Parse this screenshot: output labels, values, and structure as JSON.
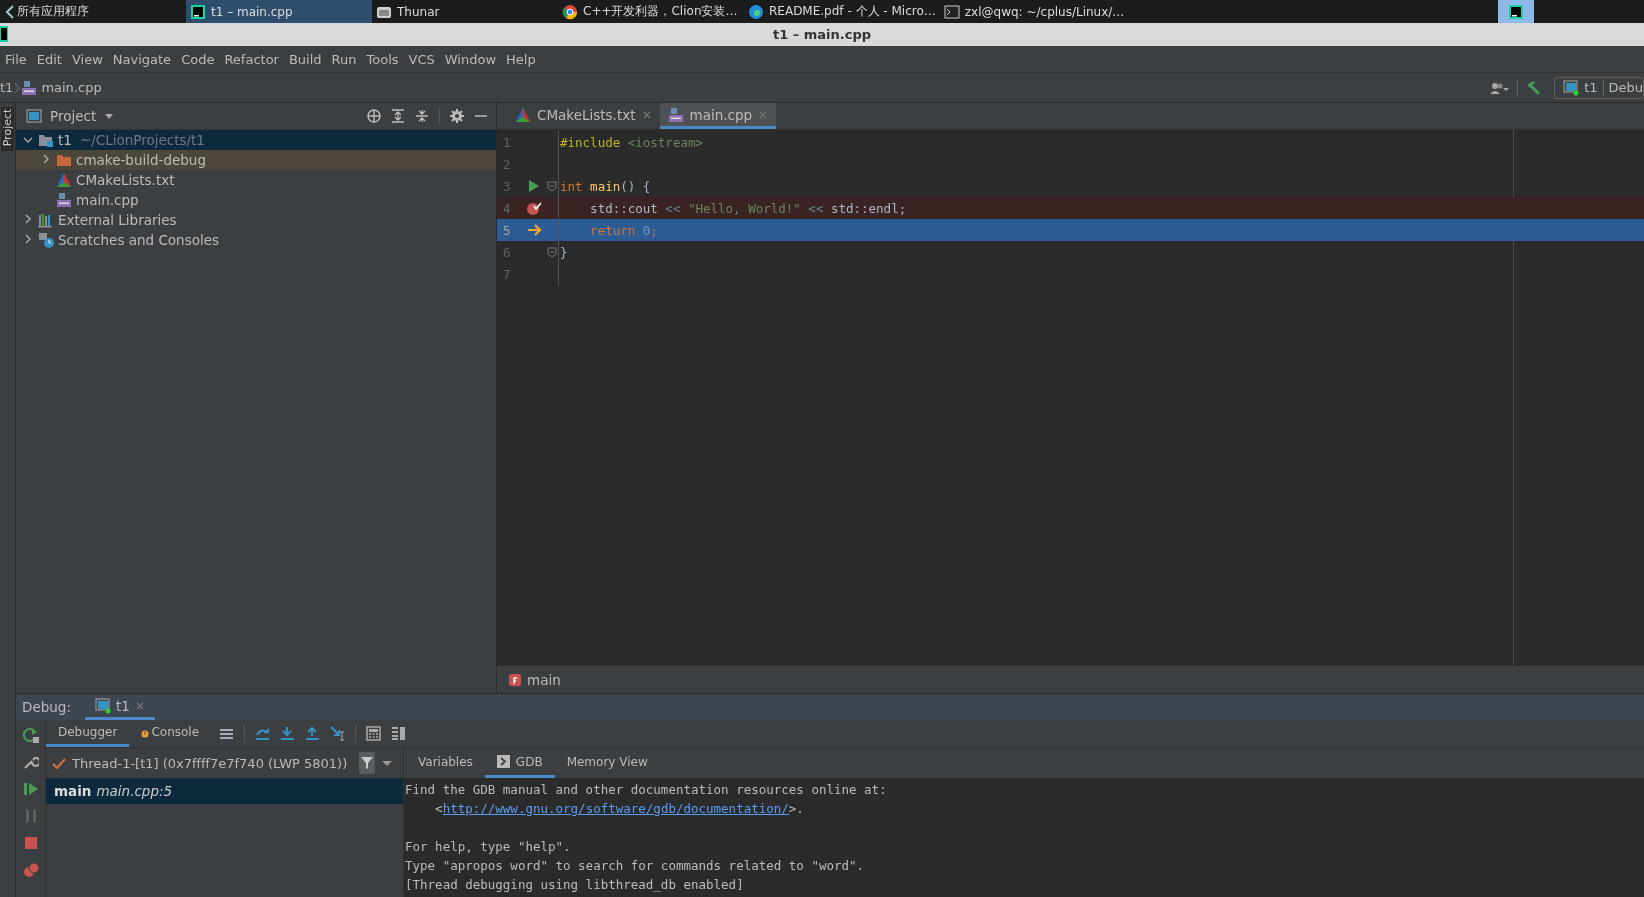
{
  "taskbar": {
    "items": [
      {
        "label": "所有应用程序",
        "kind": "start",
        "selected": false
      },
      {
        "label": "t1 – main.cpp",
        "kind": "clion",
        "selected": true
      },
      {
        "label": "Thunar",
        "kind": "files",
        "selected": false
      },
      {
        "label": "C++开发利器，Clion安装…",
        "kind": "browser",
        "selected": false
      },
      {
        "label": "README.pdf - 个人 - Micro…",
        "kind": "edge",
        "selected": false
      },
      {
        "label": "zxl@qwq: ~/cplus/Linux/…",
        "kind": "terminal",
        "selected": false
      }
    ]
  },
  "window": {
    "title": "t1 – main.cpp"
  },
  "menu": [
    "File",
    "Edit",
    "View",
    "Navigate",
    "Code",
    "Refactor",
    "Build",
    "Run",
    "Tools",
    "VCS",
    "Window",
    "Help"
  ],
  "navbar": {
    "crumbs": [
      "t1",
      "main.cpp"
    ],
    "run_config": {
      "name": "t1",
      "mode": "Debu"
    }
  },
  "side_strip": {
    "label": "Project"
  },
  "project_panel": {
    "title": "Project",
    "tree": [
      {
        "name": "t1",
        "path": "~/CLionProjects/t1",
        "kind": "module",
        "expanded": true,
        "selected": true,
        "hovered": false,
        "children": [
          {
            "name": "cmake-build-debug",
            "kind": "folder",
            "expanded": false,
            "selected": false,
            "hovered": true
          },
          {
            "name": "CMakeLists.txt",
            "kind": "cmake",
            "selected": false,
            "hovered": false
          },
          {
            "name": "main.cpp",
            "kind": "cpp",
            "selected": false,
            "hovered": false
          }
        ]
      },
      {
        "name": "External Libraries",
        "kind": "libraries",
        "expanded": false,
        "selected": false,
        "hovered": false
      },
      {
        "name": "Scratches and Consoles",
        "kind": "scratches",
        "expanded": false,
        "selected": false,
        "hovered": false
      }
    ]
  },
  "editor": {
    "tabs": [
      {
        "label": "CMakeLists.txt",
        "kind": "cmake",
        "selected": false
      },
      {
        "label": "main.cpp",
        "kind": "cpp",
        "selected": true
      }
    ],
    "lines": [
      {
        "number": "1",
        "runnable": false,
        "breakpoint": false,
        "current": false,
        "fold": false,
        "tokens": [
          {
            "text": "#include ",
            "kind": "preproc"
          },
          {
            "text": "<iostream>",
            "kind": "header"
          }
        ]
      },
      {
        "number": "2",
        "runnable": false,
        "breakpoint": false,
        "current": false,
        "fold": false
      },
      {
        "number": "3",
        "runnable": true,
        "breakpoint": false,
        "current": false,
        "fold": true,
        "tokens": [
          {
            "text": "int ",
            "kind": "keyword"
          },
          {
            "text": "main",
            "kind": "function"
          },
          {
            "text": "() {",
            "kind": "plain"
          }
        ]
      },
      {
        "number": "4",
        "runnable": false,
        "breakpoint": true,
        "current": false,
        "fold": false,
        "tokens": [
          {
            "text": "    std::cout ",
            "kind": "plain"
          },
          {
            "text": "<< ",
            "kind": "operator"
          },
          {
            "text": "\"Hello, World!\" ",
            "kind": "string"
          },
          {
            "text": "<< ",
            "kind": "operator"
          },
          {
            "text": "std::endl;",
            "kind": "plain"
          }
        ]
      },
      {
        "number": "5",
        "runnable": false,
        "breakpoint": false,
        "current": true,
        "fold": false,
        "tokens": [
          {
            "text": "    return ",
            "kind": "keyword"
          },
          {
            "text": "0",
            "kind": "number"
          },
          {
            "text": ";",
            "kind": "keyword"
          }
        ]
      },
      {
        "number": "6",
        "runnable": false,
        "breakpoint": false,
        "current": false,
        "fold": true,
        "tokens": [
          {
            "text": "}",
            "kind": "plain"
          }
        ]
      },
      {
        "number": "7",
        "runnable": false,
        "breakpoint": false,
        "current": false,
        "fold": false
      }
    ],
    "breadcrumb": "main"
  },
  "debug": {
    "label": "Debug:",
    "session_tabs": [
      {
        "label": "t1",
        "selected": true
      }
    ],
    "tool_tabs": [
      {
        "label": "Debugger",
        "selected": true,
        "warning": false
      },
      {
        "label": "Console",
        "selected": false,
        "warning": true
      }
    ],
    "thread": "Thread-1-[t1] (0x7ffff7e7f740 (LWP 5801))",
    "frames": [
      {
        "function": "main",
        "location": "main.cpp:5",
        "selected": true
      }
    ],
    "console_tabs": [
      {
        "label": "Variables",
        "selected": false,
        "icon": false
      },
      {
        "label": "GDB",
        "selected": true,
        "icon": true
      },
      {
        "label": "Memory View",
        "selected": false,
        "icon": false
      }
    ],
    "console_lines": [
      {
        "kind": "text",
        "text": "Find the GDB manual and other documentation resources online at:"
      },
      {
        "kind": "link",
        "before": "    <",
        "link": "http://www.gnu.org/software/gdb/documentation/",
        "after": ">."
      },
      {
        "kind": "blank"
      },
      {
        "kind": "text",
        "text": "For help, type \"help\"."
      },
      {
        "kind": "text",
        "text": "Type \"apropos word\" to search for commands related to \"word\"."
      },
      {
        "kind": "text",
        "text": "[Thread debugging using libthread_db enabled]"
      }
    ]
  }
}
